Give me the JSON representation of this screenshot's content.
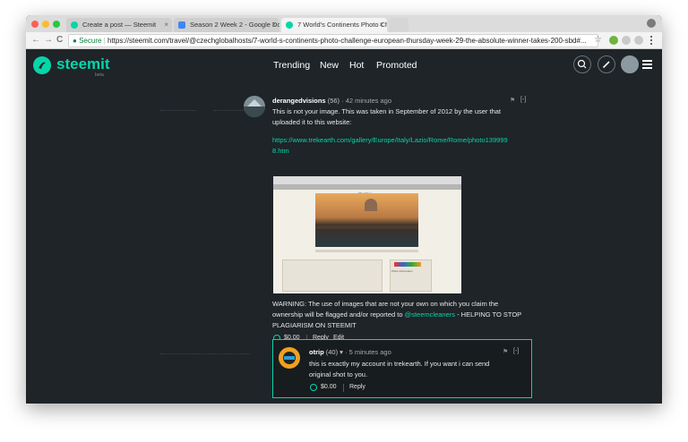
{
  "browser": {
    "tabs": [
      {
        "label": "Create a post — Steemit",
        "icon": "steemit-favicon",
        "close": "×"
      },
      {
        "label": "Season 2 Week 2 - Google Do",
        "icon": "docs-favicon",
        "close": "×"
      },
      {
        "label": "7 World's Continents Photo Ch",
        "icon": "steemit-favicon",
        "close": "×"
      }
    ],
    "secure_label": "Secure",
    "url": "https://steemit.com/travel/@czechglobalhosts/7-world-s-continents-photo-challenge-european-thursday-week-29-the-absolute-winner-takes-200-sbd#...",
    "nav_icons": [
      "back-arrow-icon",
      "forward-arrow-icon",
      "reload-icon"
    ],
    "back": "←",
    "forward": "→",
    "reload": "C",
    "star": "☆"
  },
  "header": {
    "logo": "steemit",
    "beta": "beta",
    "nav": [
      "Trending",
      "New",
      "Hot",
      "Promoted"
    ],
    "icons": [
      "search-icon",
      "pencil-icon",
      "user-avatar",
      "hamburger-icon"
    ]
  },
  "comment1": {
    "author": "derangedvisions",
    "rep": "(56)",
    "time": "· 42 minutes ago",
    "line1": "This is not your image. This was taken in September of 2012 by the user that",
    "line2": "uploaded it to this website:",
    "link1": "https://www.trekearth.com/gallery/Europe/Italy/Lazio/Rome/Rome/photo139999",
    "link2": "8.htm",
    "warn1": "WARNING: The use of images that are not your own on which you claim the",
    "warn2a": "ownership will be flagged and/or reported to ",
    "warn2_link": "@steemcleaners",
    "warn2b": " - HELPING TO STOP",
    "warn3": "PLAGIARISM ON STEEMIT",
    "payout": "$0.00",
    "reply": "Reply",
    "edit": "Edit",
    "collapse": "[-]",
    "embed": {
      "title": "Tiber River",
      "photo_info": "Photo Information"
    }
  },
  "comment2": {
    "author": "otrip",
    "rep": "(40) ▾",
    "time": "· 5 minutes ago",
    "line1": "this is exactly my account in trekearth. If you want i can send",
    "line2": "original shot to you.",
    "payout": "$0.00",
    "reply": "Reply",
    "collapse": "[-]"
  },
  "colors": {
    "accent": "#06d6a9",
    "background": "#1e2428"
  }
}
